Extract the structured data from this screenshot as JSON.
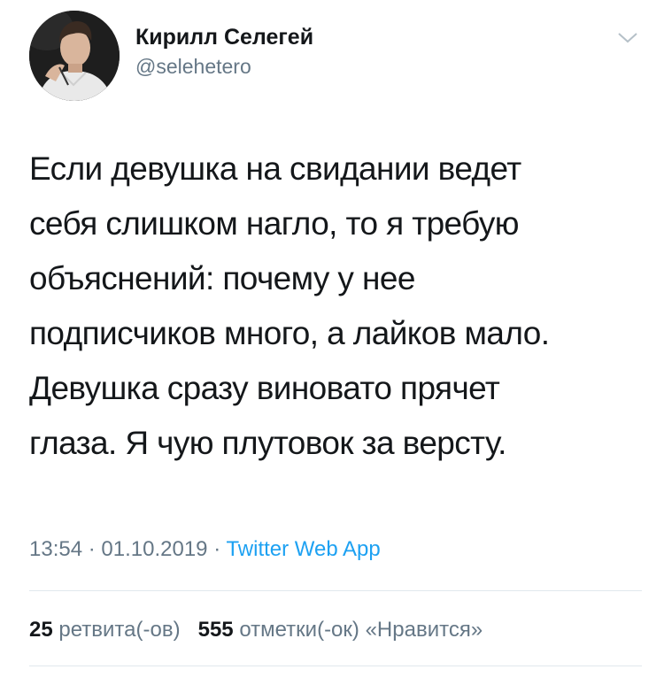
{
  "author": {
    "display_name": "Кирилл Селегей",
    "handle": "@selehetero",
    "avatar_icon": "user-avatar-photo"
  },
  "menu": {
    "icon": "chevron-down-icon"
  },
  "tweet": {
    "lines": [
      "Если девушка на свидании ведет",
      "себя слишком нагло, то я требую",
      "объяснений: почему у нее",
      "подписчиков много, а лайков мало.",
      "Девушка сразу виновато прячет",
      "глаза. Я чую плутовок за версту."
    ]
  },
  "meta": {
    "time": "13:54",
    "separator": "·",
    "date": "01.10.2019",
    "source": "Twitter Web App"
  },
  "stats": {
    "retweets_count": "25",
    "retweets_label": "ретвита(-ов)",
    "likes_count": "555",
    "likes_label": "отметки(-ок) «Нравится»"
  },
  "colors": {
    "text": "#14171a",
    "secondary": "#657786",
    "link": "#1da1f2",
    "divider": "#e1e8ed"
  }
}
